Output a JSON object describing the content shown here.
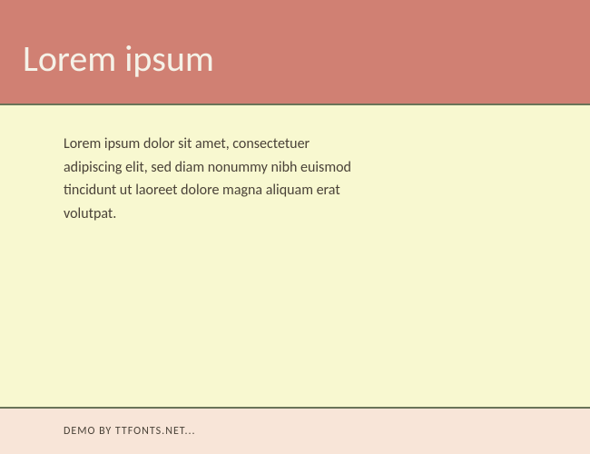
{
  "header": {
    "title": "Lorem ipsum"
  },
  "content": {
    "text": "Lorem ipsum dolor sit amet, consectetuer adipiscing elit, sed diam nonummy nibh euismod tincidunt ut laoreet dolore magna aliquam erat volutpat."
  },
  "footer": {
    "text": "DEMO BY TTFONTS.NET..."
  }
}
